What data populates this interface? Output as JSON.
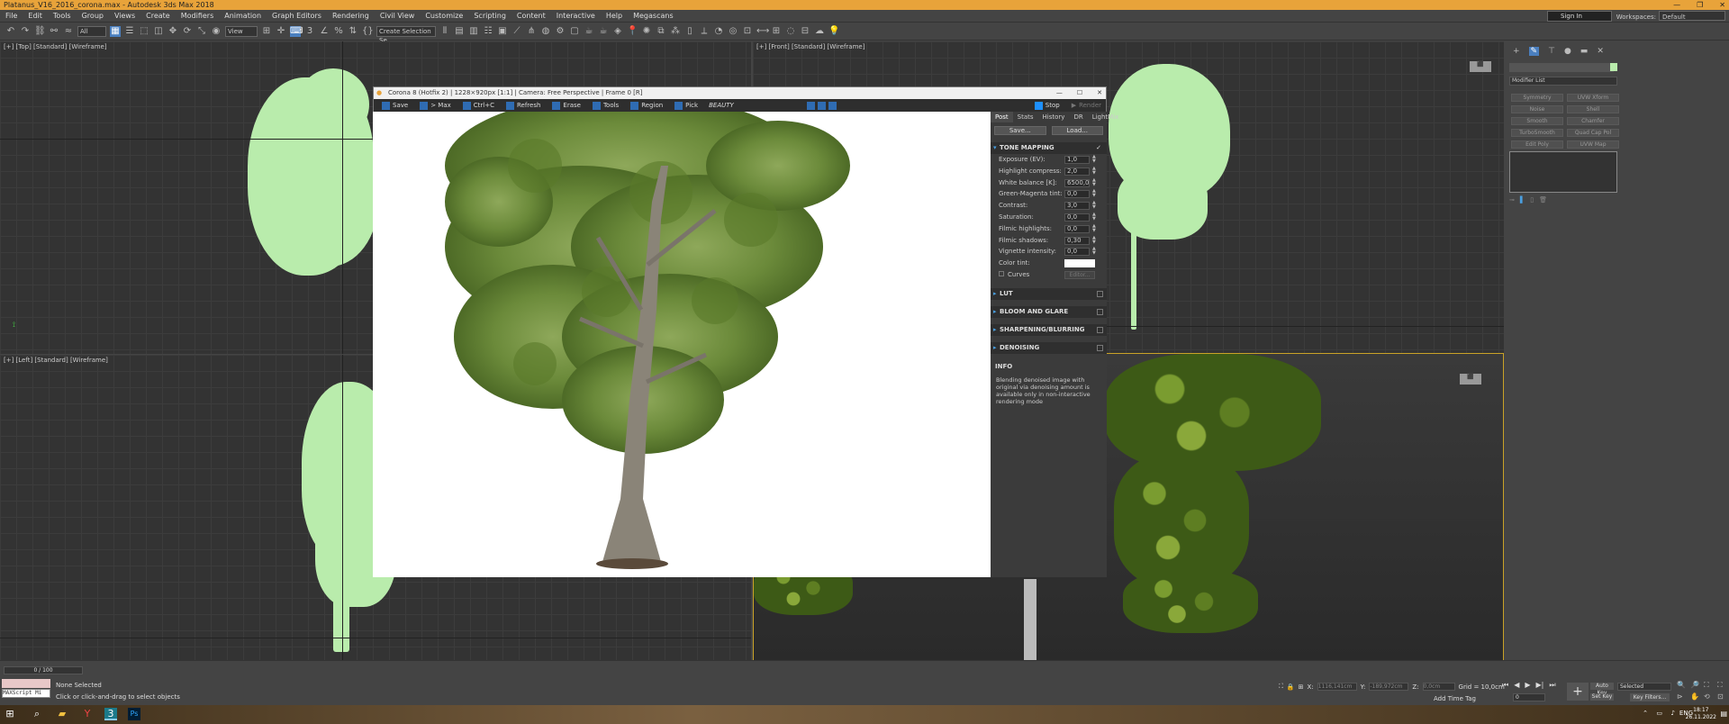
{
  "app": {
    "title": "Platanus_V16_2016_corona.max - Autodesk 3ds Max 2018",
    "sign_in": "Sign In",
    "workspaces_label": "Workspaces:",
    "workspace_value": "Default"
  },
  "menu": [
    "File",
    "Edit",
    "Tools",
    "Group",
    "Views",
    "Create",
    "Modifiers",
    "Animation",
    "Graph Editors",
    "Rendering",
    "Civil View",
    "Customize",
    "Scripting",
    "Content",
    "Interactive",
    "Help",
    "Megascans"
  ],
  "toolbar": {
    "filter": "All",
    "view": "View",
    "selection_set": "Create Selection Se"
  },
  "viewports": {
    "top": "[+] [Top] [Standard] [Wireframe]",
    "front": "[+] [Front] [Standard] [Wireframe]",
    "left": "[+] [Left] [Standard] [Wireframe]"
  },
  "vfe": {
    "title": "Corona 8 (Hotfix 2) | 1228×920px [1:1] | Camera: Free Perspective | Frame 0 [R]",
    "buttons": [
      "Save",
      "> Max",
      "Ctrl+C",
      "Refresh",
      "Erase",
      "Tools",
      "Region",
      "Pick"
    ],
    "channel": "BEAUTY",
    "stop": "Stop",
    "render": "Render",
    "tabs": [
      "Post",
      "Stats",
      "History",
      "DR",
      "LightMix"
    ],
    "save_btn": "Save...",
    "load_btn": "Load...",
    "tone_mapping": "TONE MAPPING",
    "rows": [
      {
        "label": "Exposure (EV):",
        "value": "1,0"
      },
      {
        "label": "Highlight compress:",
        "value": "2,0"
      },
      {
        "label": "White balance [K]:",
        "value": "6500,0"
      },
      {
        "label": "Green-Magenta tint:",
        "value": "0,0"
      },
      {
        "label": "Contrast:",
        "value": "3,0"
      },
      {
        "label": "Saturation:",
        "value": "0,0"
      },
      {
        "label": "Filmic highlights:",
        "value": "0,0"
      },
      {
        "label": "Filmic shadows:",
        "value": "0,30"
      },
      {
        "label": "Vignette intensity:",
        "value": "0,0"
      }
    ],
    "color_tint": "Color tint:",
    "curves": "Curves",
    "curves_btn": "Editor...",
    "sections": [
      "LUT",
      "BLOOM AND GLARE",
      "SHARPENING/BLURRING",
      "DENOISING"
    ],
    "info_title": "INFO",
    "info_text": "Blending denoised image with original via denoising amount is available only in non-interactive rendering mode"
  },
  "command_panel": {
    "modifier_list": "Modifier List",
    "buttons": [
      "Symmetry",
      "UVW Xform",
      "Noise",
      "Shell",
      "Smooth",
      "Chamfer",
      "TurboSmooth",
      "Quad Cap Pol",
      "Edit Poly",
      "UVW Map"
    ]
  },
  "status": {
    "frame": "0 / 100",
    "none_selected": "None Selected",
    "hint": "Click or click-and-drag to select objects",
    "maxscript": "MAXScript Mi",
    "x_label": "X:",
    "x_val": "1116,141cm",
    "y_label": "Y:",
    "y_val": "-189,972cm",
    "z_label": "Z:",
    "z_val": "0,0cm",
    "grid": "Grid = 10,0cm",
    "add_time_tag": "Add Time Tag",
    "auto_key": "Auto Key",
    "selected": "Selected",
    "set_key": "Set Key",
    "key_filters": "Key Filters...",
    "frame_num": "0"
  },
  "taskbar": {
    "lang": "ENG",
    "time": "18:17",
    "date": "26.11.2022"
  }
}
